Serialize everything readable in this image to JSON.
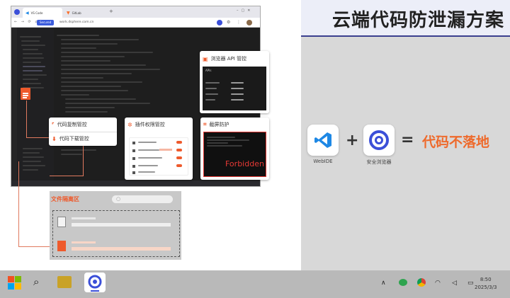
{
  "title": "云端代码防泄漏方案",
  "browser": {
    "tabs": [
      "VS Code",
      "GitLab"
    ],
    "add_tab": "+",
    "secured": "Secured",
    "url": "work.dsphere.com.cn"
  },
  "cards": {
    "copy": "代码复制管控",
    "download": "代码下载管控",
    "plugin": "插件权限管控",
    "screenshot": "截屏防护",
    "api": "浏览器 API 管控",
    "api_tab": "APIs",
    "forbidden": "Forbidden"
  },
  "isolation": {
    "title": "文件隔离区"
  },
  "formula": {
    "app1": "WebIDE",
    "plus": "+",
    "app2": "安全浏览器",
    "equals": "=",
    "result": "代码不落地"
  },
  "clock": {
    "time": "8:50",
    "date": "2025/3/3"
  },
  "colors": {
    "accent": "#ee6a2c",
    "brand": "#3b3f8f"
  }
}
